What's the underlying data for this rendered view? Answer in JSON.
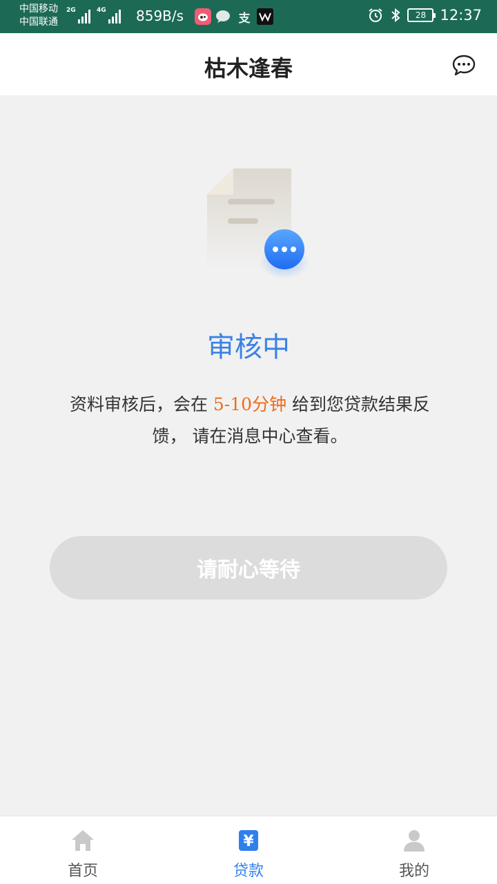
{
  "status_bar": {
    "carrier1": "中国移动",
    "carrier2": "中国联通",
    "sig1_tag": "2G",
    "sig2_tag": "4G",
    "net_speed": "859B/s",
    "app_icons": [
      "weibo-icon",
      "wechat-icon",
      "alipay-icon",
      "app-icon"
    ],
    "alipay_glyph": "支",
    "battery": "28",
    "time": "12:37"
  },
  "header": {
    "title": "枯木逢春",
    "message_icon": "chat-bubble-icon"
  },
  "main": {
    "status": "审核中",
    "desc_prefix": "资料审核后，会在 ",
    "desc_highlight": "5-10分钟",
    "desc_suffix": " 给到您贷款结果反馈， 请在消息中心查看。",
    "button_label": "请耐心等待",
    "colors": {
      "accent": "#3b82e6",
      "highlight": "#ef6b1a",
      "button_bg": "#dcdcdc"
    }
  },
  "tabbar": {
    "items": [
      {
        "label": "首页",
        "icon": "home-icon"
      },
      {
        "label": "贷款",
        "icon": "yuan-icon",
        "glyph": "¥"
      },
      {
        "label": "我的",
        "icon": "user-icon"
      }
    ],
    "active_index": 1
  }
}
